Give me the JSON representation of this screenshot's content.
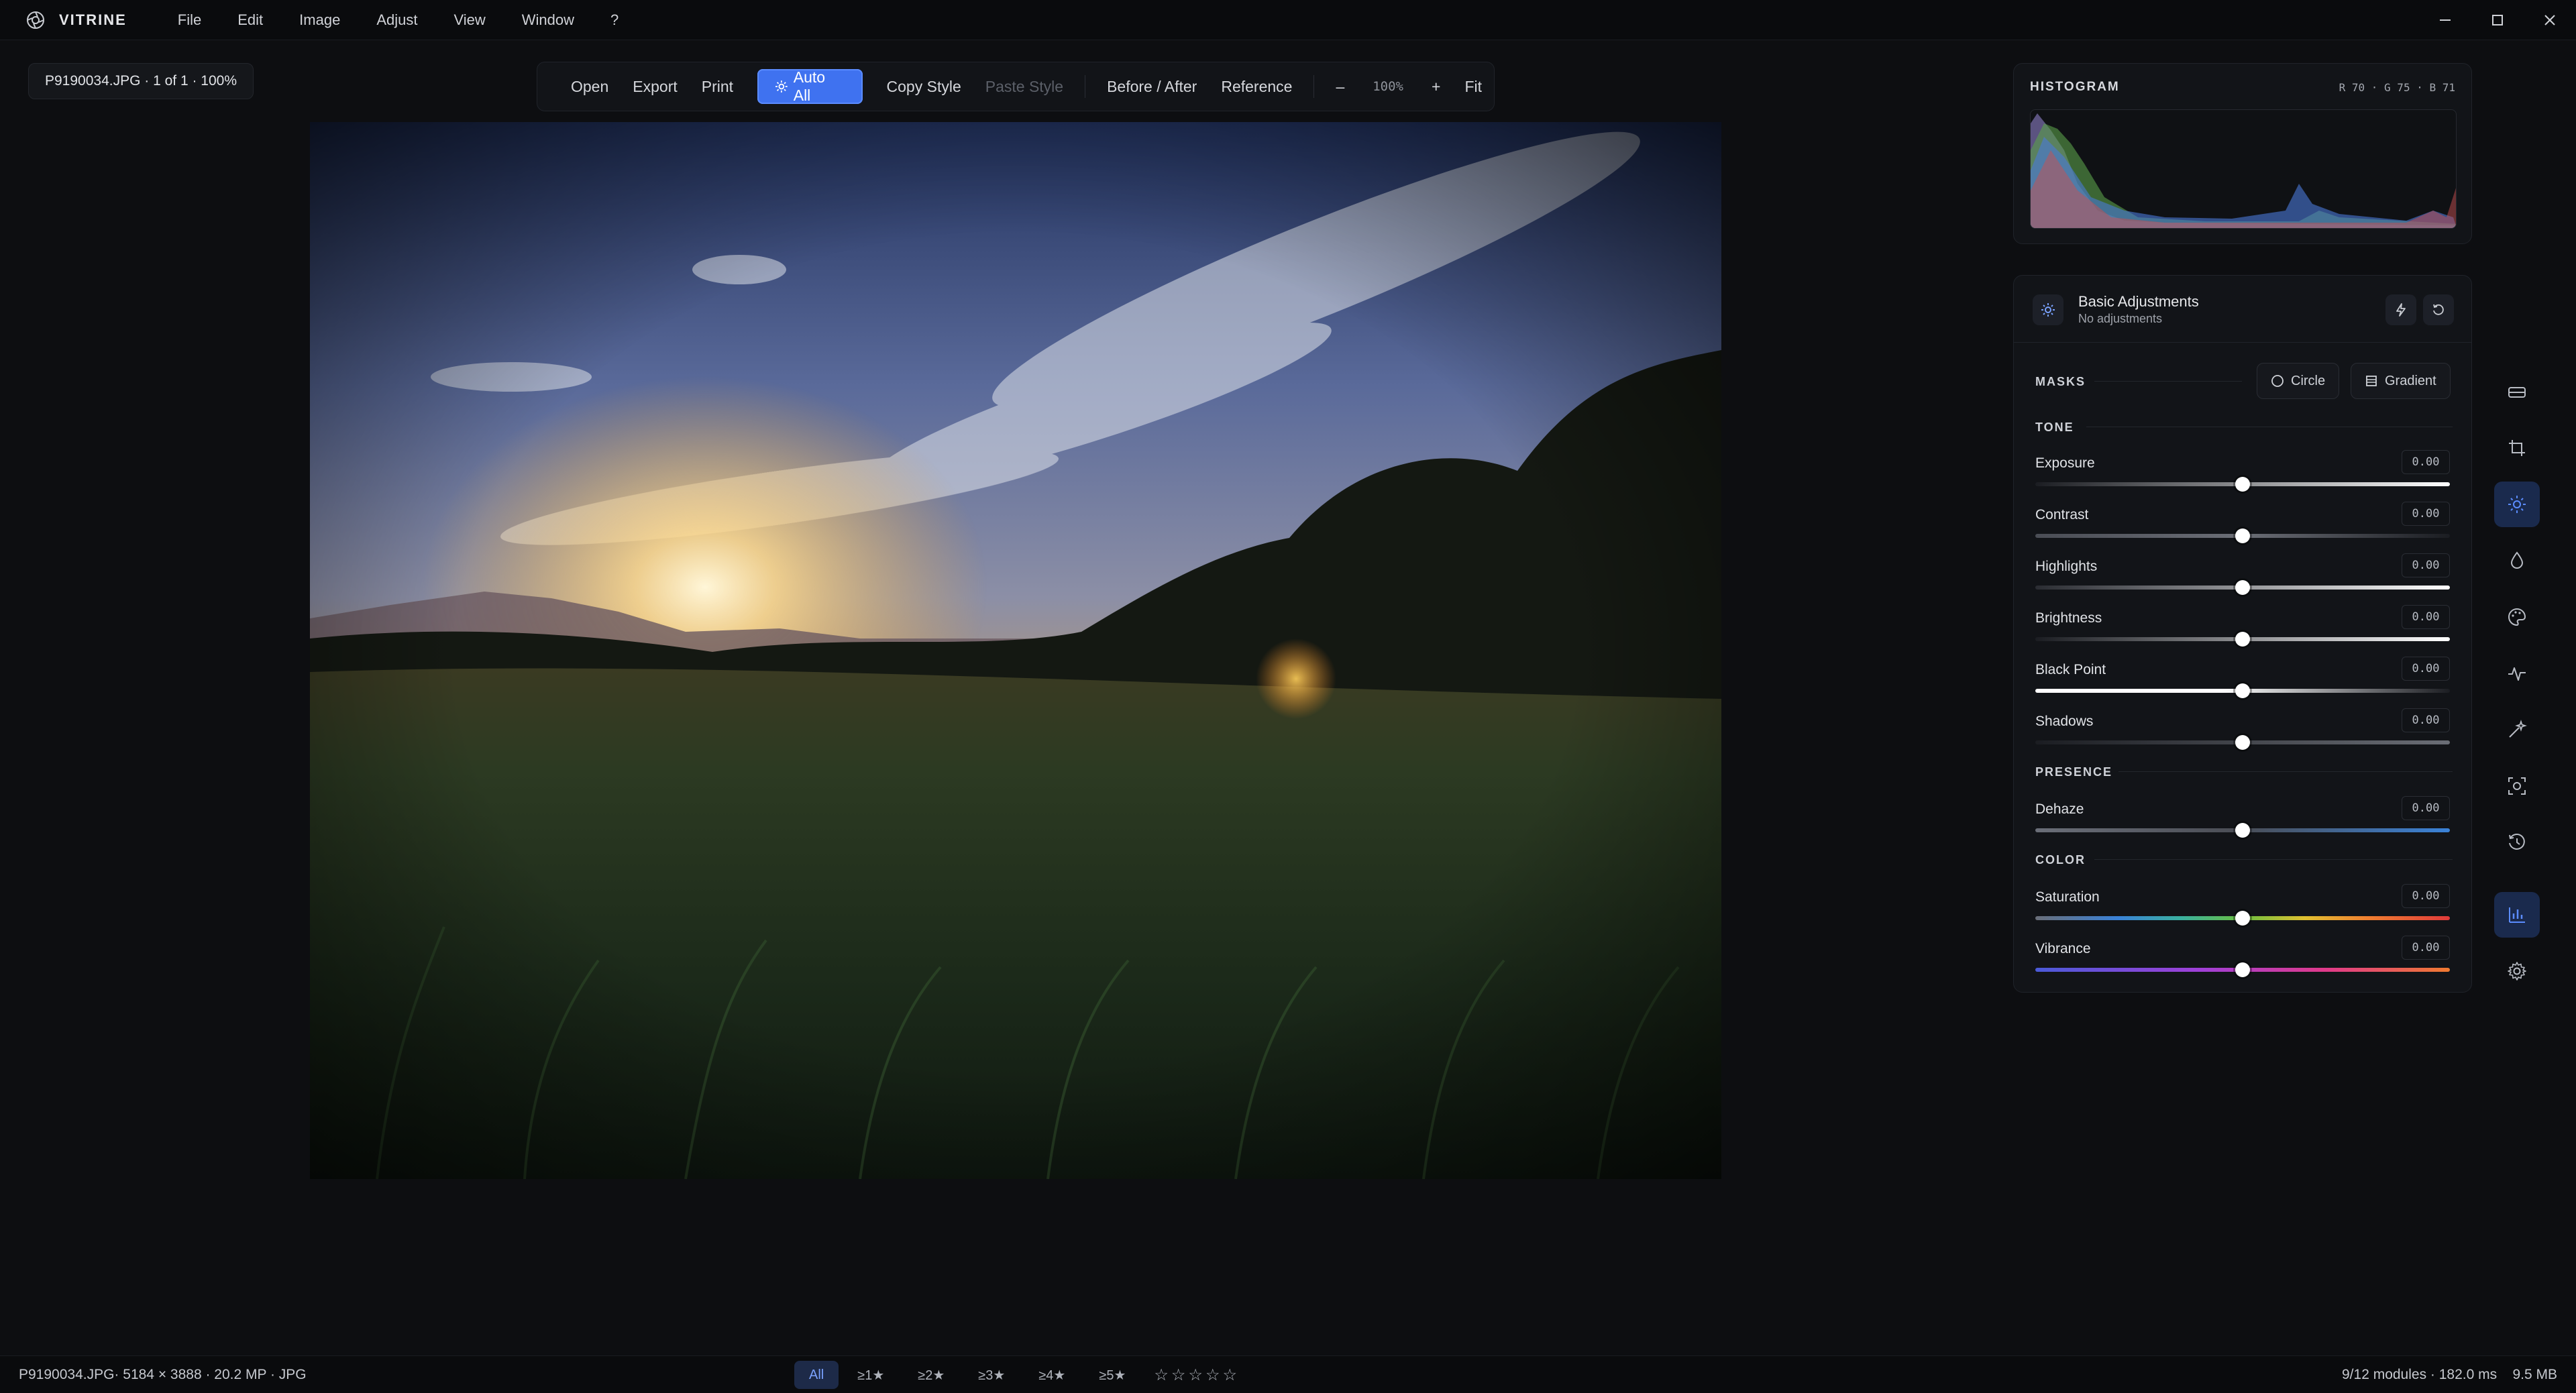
{
  "titlebar": {
    "app_name": "VITRINE",
    "menu": [
      "File",
      "Edit",
      "Image",
      "Adjust",
      "View",
      "Window",
      "?"
    ]
  },
  "file_info": "P9190034.JPG · 1 of 1 · 100%",
  "toolbar": {
    "open": "Open",
    "export": "Export",
    "print": "Print",
    "auto_all": "Auto All",
    "copy_style": "Copy Style",
    "paste_style": "Paste Style",
    "before_after": "Before / After",
    "reference": "Reference",
    "zoom_out": "–",
    "zoom": "100%",
    "zoom_in": "+",
    "fit": "Fit"
  },
  "histogram": {
    "title": "HISTOGRAM",
    "rgb": "R 70 · G 75 · B 71"
  },
  "adjustments": {
    "title": "Basic Adjustments",
    "subtitle": "No adjustments",
    "masks_label": "MASKS",
    "mask_circle": "Circle",
    "mask_gradient": "Gradient",
    "sections": {
      "tone": "TONE",
      "presence": "PRESENCE",
      "color": "COLOR"
    },
    "sliders": [
      {
        "label": "Exposure",
        "value": "0.00",
        "position": 0.5
      },
      {
        "label": "Contrast",
        "value": "0.00",
        "position": 0.5
      },
      {
        "label": "Highlights",
        "value": "0.00",
        "position": 0.5
      },
      {
        "label": "Brightness",
        "value": "0.00",
        "position": 0.5
      },
      {
        "label": "Black Point",
        "value": "0.00",
        "position": 0.5
      },
      {
        "label": "Shadows",
        "value": "0.00",
        "position": 0.5
      },
      {
        "label": "Dehaze",
        "value": "0.00",
        "position": 0.5
      },
      {
        "label": "Saturation",
        "value": "0.00",
        "position": 0.5
      },
      {
        "label": "Vibrance",
        "value": "0.00",
        "position": 0.5
      }
    ]
  },
  "statusbar": {
    "file_details": "P9190034.JPG· 5184 × 3888 · 20.2 MP · JPG",
    "filters": [
      "All",
      "≥1★",
      "≥2★",
      "≥3★",
      "≥4★",
      "≥5★"
    ],
    "active_filter": "All",
    "stats": "9/12 modules · 182.0 ms    9.5 MB"
  },
  "colors": {
    "accent": "#3f72f0",
    "background": "#0d0e11",
    "panel": "#121418"
  }
}
